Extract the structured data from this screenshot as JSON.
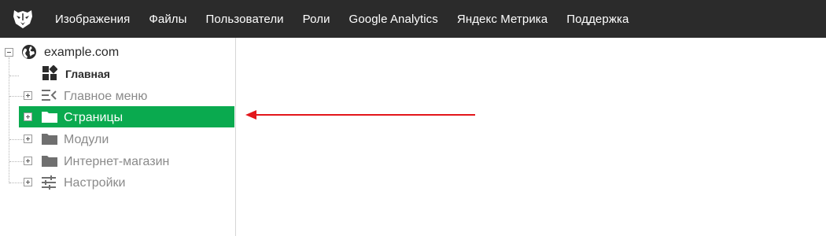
{
  "topbar": {
    "logo_icon": "panther-head-logo",
    "nav": [
      {
        "label": "Изображения"
      },
      {
        "label": "Файлы"
      },
      {
        "label": "Пользователи"
      },
      {
        "label": "Роли"
      },
      {
        "label": "Google Analytics"
      },
      {
        "label": "Яндекс Метрика"
      },
      {
        "label": "Поддержка"
      }
    ]
  },
  "tree": {
    "root": {
      "label": "example.com",
      "icon": "globe-icon",
      "expanded": true
    },
    "items": [
      {
        "label": "Главная",
        "icon": "dashboard-icon",
        "bold": true,
        "expandable": false
      },
      {
        "label": "Главное меню",
        "icon": "menu-icon",
        "expandable": true
      },
      {
        "label": "Страницы",
        "icon": "folder-icon",
        "expandable": true,
        "selected": true
      },
      {
        "label": "Модули",
        "icon": "folder-icon",
        "expandable": true
      },
      {
        "label": "Интернет-магазин",
        "icon": "folder-icon",
        "expandable": true
      },
      {
        "label": "Настройки",
        "icon": "sliders-icon",
        "expandable": true
      }
    ]
  },
  "colors": {
    "topbar": "#2b2b2b",
    "selected": "#0aaa4f",
    "arrow": "#e3161b",
    "muted_text": "#8a8a8a"
  }
}
